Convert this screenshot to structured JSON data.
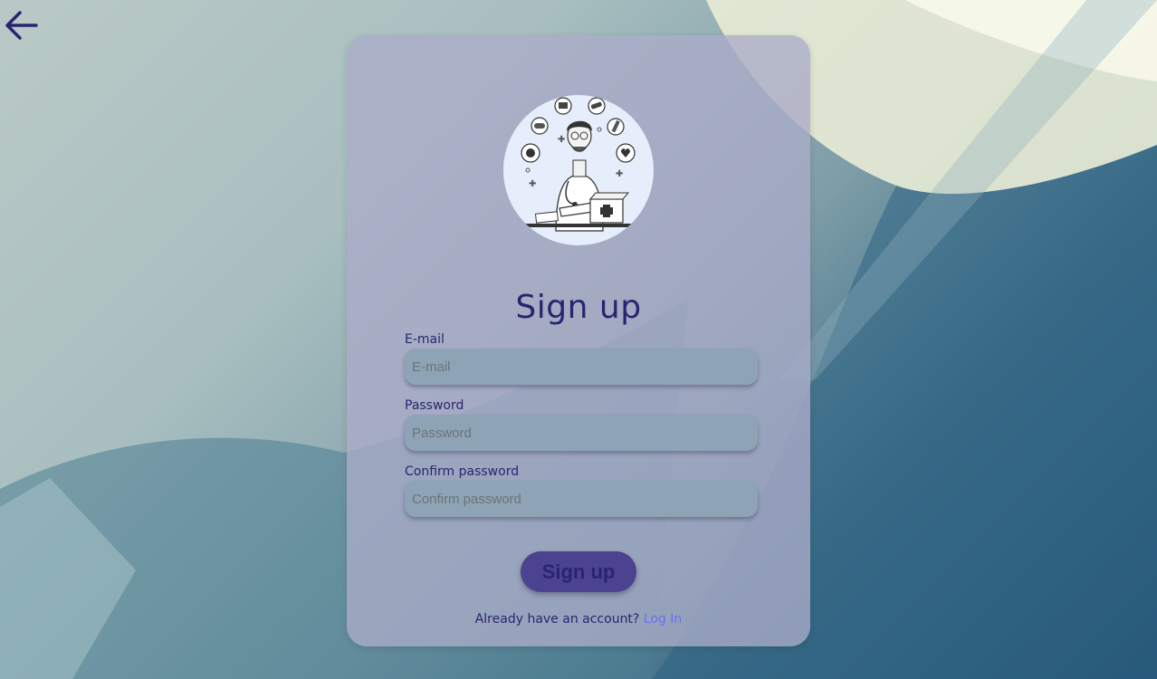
{
  "nav": {
    "back_icon": "arrow-left-icon"
  },
  "form": {
    "title": "Sign up",
    "fields": [
      {
        "label": "E-mail",
        "placeholder": "E-mail",
        "value": ""
      },
      {
        "label": "Password",
        "placeholder": "Password",
        "value": ""
      },
      {
        "label": "Confirm password",
        "placeholder": "Confirm password",
        "value": ""
      }
    ],
    "submit_label": "Sign up",
    "footer_text": "Already have an account?",
    "login_link": "Log In"
  },
  "colors": {
    "accent": "#2a2470",
    "button": "#4b4390",
    "link": "#6a6ff0",
    "input_bg": "#8ea3b6"
  }
}
